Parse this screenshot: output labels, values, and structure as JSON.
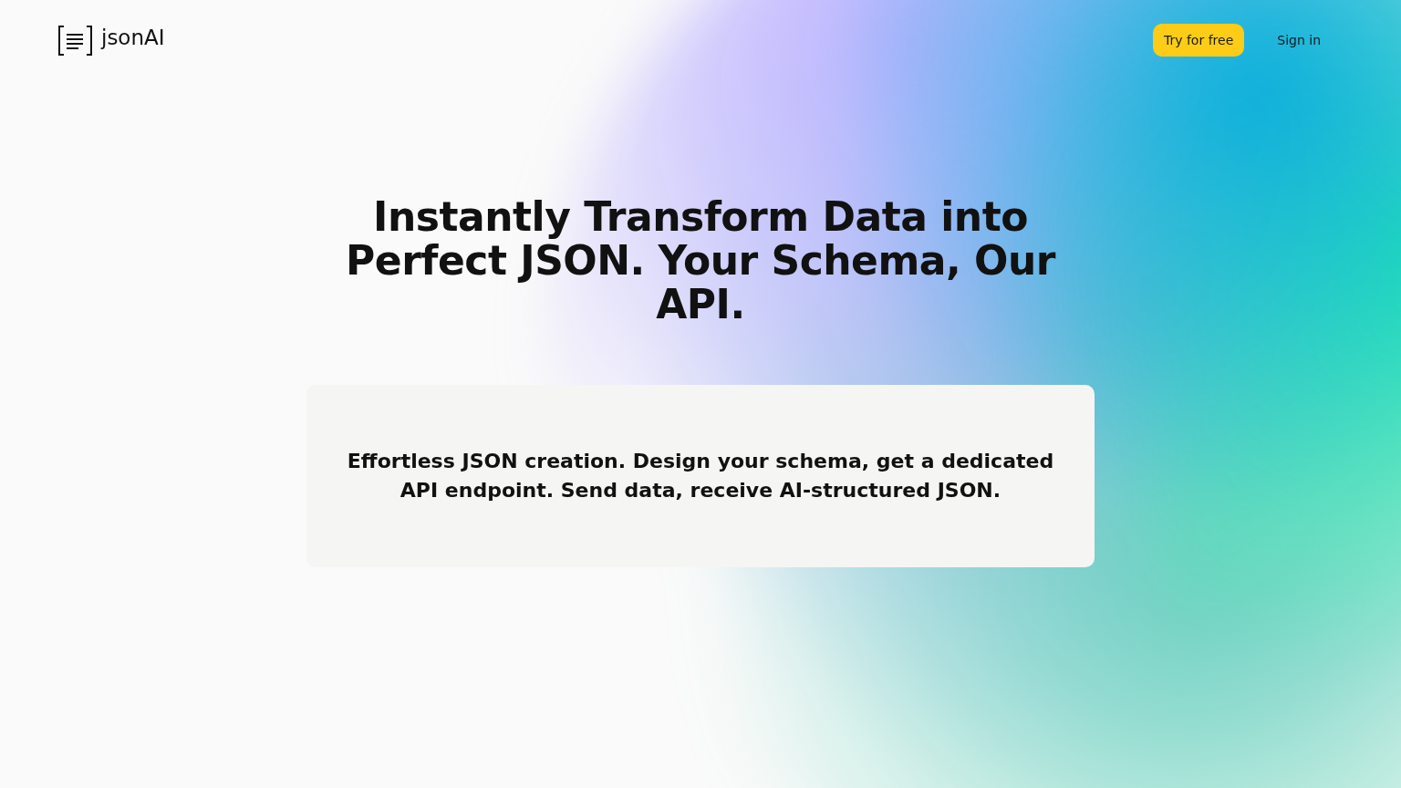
{
  "header": {
    "logo_text": "jsonAI",
    "buttons": [
      {
        "label": "Try for free",
        "kind": "primary"
      },
      {
        "label": "Sign in",
        "kind": "link"
      }
    ]
  },
  "hero": {
    "headline": "Instantly Transform Data into Perfect JSON. Your Schema, Our API.",
    "description": "Effortless JSON creation. Design your schema, get a dedicated API endpoint. Send data, receive AI-structured JSON."
  }
}
